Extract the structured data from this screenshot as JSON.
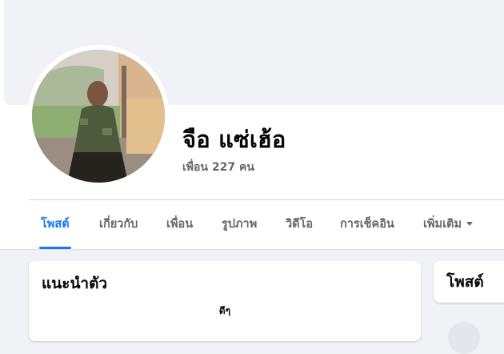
{
  "profile": {
    "name": "จือ แซ่เฮ้อ",
    "friends": "เพื่อน 227 คน"
  },
  "tabs": [
    {
      "label": "โพสต์",
      "active": true
    },
    {
      "label": "เกี่ยวกับ",
      "active": false
    },
    {
      "label": "เพื่อน",
      "active": false
    },
    {
      "label": "รูปภาพ",
      "active": false
    },
    {
      "label": "วิดีโอ",
      "active": false
    },
    {
      "label": "การเช็คอิน",
      "active": false
    },
    {
      "label": "เพิ่มเติม",
      "active": false,
      "icon": "caret-down-icon"
    }
  ],
  "intro": {
    "title": "แนะนำตัว",
    "bio": "ดีๆ"
  },
  "posts": {
    "title": "โพสต์"
  },
  "colors": {
    "accent": "#1877f2",
    "background": "#f0f2f5",
    "secondary_text": "#65676b"
  }
}
